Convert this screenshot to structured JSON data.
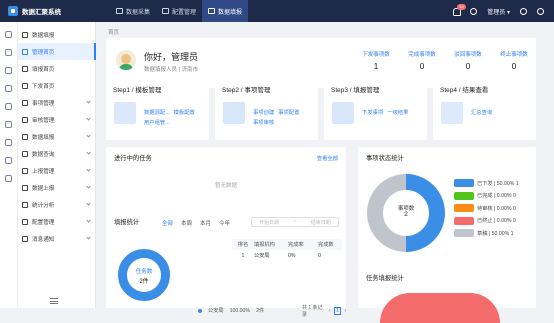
{
  "app": {
    "title": "数据汇聚系统"
  },
  "topnav": [
    {
      "label": "数据采集",
      "active": false
    },
    {
      "label": "配置管理",
      "active": false
    },
    {
      "label": "数据填报",
      "active": true
    }
  ],
  "topright": {
    "notification_count": "10",
    "user": "管理员"
  },
  "sidebar": {
    "items": [
      {
        "label": "数据填报",
        "icon": "grid-icon",
        "active": false,
        "arrow": false
      },
      {
        "label": "管理首页",
        "icon": "home-icon",
        "active": true,
        "arrow": false
      },
      {
        "label": "填报首页",
        "icon": "home-icon",
        "active": false,
        "arrow": false
      },
      {
        "label": "下发首页",
        "icon": "home-icon",
        "active": false,
        "arrow": false
      },
      {
        "label": "事项管理",
        "icon": "list-icon",
        "active": false,
        "arrow": true
      },
      {
        "label": "审核管理",
        "icon": "check-icon",
        "active": false,
        "arrow": true
      },
      {
        "label": "数据填报",
        "icon": "edit-icon",
        "active": false,
        "arrow": true
      },
      {
        "label": "数据查询",
        "icon": "search-icon",
        "active": false,
        "arrow": true
      },
      {
        "label": "上报管理",
        "icon": "upload-icon",
        "active": false,
        "arrow": true
      },
      {
        "label": "数据上报",
        "icon": "send-icon",
        "active": false,
        "arrow": true
      },
      {
        "label": "统计分析",
        "icon": "chart-icon",
        "active": false,
        "arrow": true
      },
      {
        "label": "配置管理",
        "icon": "gear-icon",
        "active": false,
        "arrow": true
      },
      {
        "label": "消息通知",
        "icon": "bell-icon",
        "active": false,
        "arrow": true
      }
    ]
  },
  "breadcrumb": "首页",
  "welcome": {
    "greeting": "你好，管理员",
    "subinfo": "数据填报人员 | 济南市",
    "stats": [
      {
        "label": "下发事项数",
        "value": "1"
      },
      {
        "label": "完成事项数",
        "value": "0"
      },
      {
        "label": "驳回事项数",
        "value": "0"
      },
      {
        "label": "终止事项数",
        "value": "0"
      }
    ]
  },
  "steps": [
    {
      "title": "Step1 / 模板管理",
      "links": [
        "数据源配...",
        "模板配置",
        "用户组管..."
      ]
    },
    {
      "title": "Step2 / 事项管理",
      "links": [
        "事项创建",
        "事项配置",
        "事项审核"
      ]
    },
    {
      "title": "Step3 / 填报管理",
      "links": [
        "下发事项",
        "一级结果"
      ]
    },
    {
      "title": "Step4 / 结果查看",
      "links": [
        "汇总查询"
      ]
    }
  ],
  "tasks": {
    "title": "进行中的任务",
    "view_all": "查看全部",
    "empty": "暂无数据"
  },
  "fill_stats": {
    "title": "填报统计",
    "tabs": [
      "全部",
      "本周",
      "本月",
      "今年"
    ],
    "date_start": "开始日期",
    "date_sep": "~",
    "date_end": "结束日期",
    "ring_label": "任务数",
    "ring_value": "2件",
    "table_headers": [
      "排名",
      "填报机构",
      "完成率",
      "完成数"
    ],
    "table_rows": [
      [
        "1",
        "公安局",
        "0%",
        "0"
      ]
    ],
    "legend_name": "公安局",
    "legend_pct": "100.00%",
    "legend_count": "2件",
    "pager_total": "共 1 条记录",
    "page": "1"
  },
  "status_stats": {
    "title": "事项状态统计",
    "center_label": "事项数",
    "center_value": "2",
    "legend": [
      {
        "label": "已下发 | 50.00% 1",
        "color": "#3a8ee6"
      },
      {
        "label": "已完成 | 0.00% 0",
        "color": "#52c41a"
      },
      {
        "label": "待审核 | 0.00% 0",
        "color": "#fa8c16"
      },
      {
        "label": "已终止 | 0.00% 0",
        "color": "#f56c6c"
      },
      {
        "label": "草稿 | 50.00% 1",
        "color": "#c0c4cc"
      }
    ],
    "chart_data": {
      "type": "pie",
      "categories": [
        "已下发",
        "已完成",
        "待审核",
        "已终止",
        "草稿"
      ],
      "values": [
        1,
        0,
        0,
        0,
        1
      ]
    }
  },
  "task_fill_stats": {
    "title": "任务填报统计"
  }
}
